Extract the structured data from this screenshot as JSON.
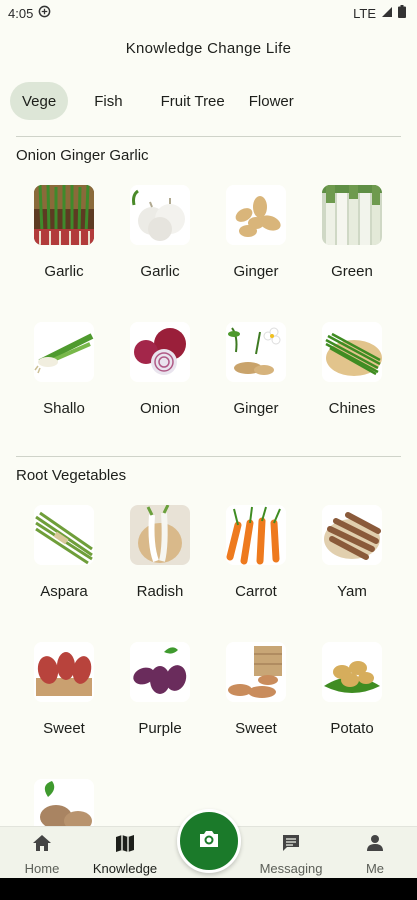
{
  "status_bar": {
    "time": "4:05",
    "network": "LTE"
  },
  "app_title": "Knowledge Change Life",
  "tabs": [
    {
      "label": "Vege",
      "active": true
    },
    {
      "label": "Fish",
      "active": false
    },
    {
      "label": "Fruit Tree",
      "active": false
    },
    {
      "label": "Flower",
      "active": false
    }
  ],
  "sections": [
    {
      "title": "Onion Ginger Garlic",
      "items": [
        {
          "label": "Garlic",
          "icon": "green-garlic-image"
        },
        {
          "label": "Garlic",
          "icon": "garlic-bulb-image"
        },
        {
          "label": "Ginger",
          "icon": "ginger-root-image"
        },
        {
          "label": "Green",
          "icon": "green-onion-image"
        },
        {
          "label": "Shallo",
          "icon": "shallot-image"
        },
        {
          "label": "Onion",
          "icon": "red-onion-image"
        },
        {
          "label": "Ginger",
          "icon": "ginger-flower-image"
        },
        {
          "label": "Chines",
          "icon": "chinese-chive-image"
        }
      ]
    },
    {
      "title": "Root Vegetables",
      "items": [
        {
          "label": "Aspara",
          "icon": "asparagus-image"
        },
        {
          "label": "Radish",
          "icon": "radish-image"
        },
        {
          "label": "Carrot",
          "icon": "carrot-image"
        },
        {
          "label": "Yam",
          "icon": "yam-image"
        },
        {
          "label": "Sweet",
          "icon": "sweet-potato-image"
        },
        {
          "label": "Purple",
          "icon": "purple-potato-image"
        },
        {
          "label": "Sweet",
          "icon": "sweet-potato-basket-image"
        },
        {
          "label": "Potato",
          "icon": "potato-image"
        },
        {
          "label": "",
          "icon": "taro-image"
        }
      ]
    }
  ],
  "bottom_nav": [
    {
      "label": "Home",
      "icon": "home-icon",
      "active": false
    },
    {
      "label": "Knowledge",
      "icon": "map-icon",
      "active": true
    },
    {
      "label": "Messaging",
      "icon": "chat-icon",
      "active": false
    },
    {
      "label": "Me",
      "icon": "person-icon",
      "active": false
    }
  ],
  "fab": {
    "icon": "camera-icon"
  },
  "colors": {
    "accent": "#1b7a2a",
    "active_tab_bg": "#dde6d7",
    "background": "#fbfcf5"
  }
}
